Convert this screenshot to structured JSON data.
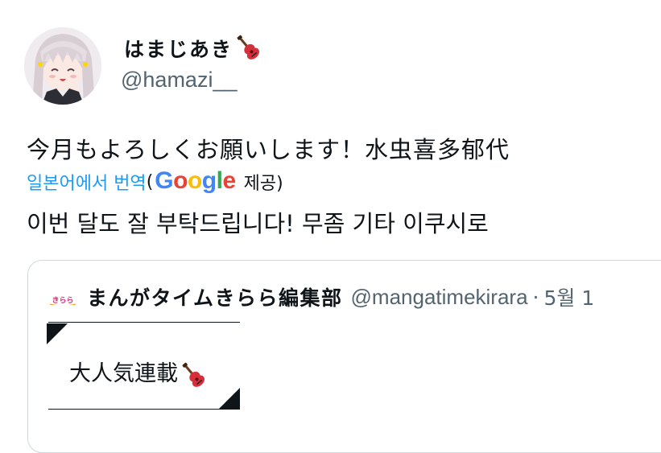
{
  "author": {
    "display_name": "はまじあき",
    "handle": "@hamazi__"
  },
  "tweet": {
    "text": "今月もよろしくお願いします！水虫喜多郁代",
    "translate_link": "일본어에서 번역",
    "paren_open": "(",
    "google_logo": "Google",
    "provided_by": "제공)",
    "translated_text": "이번 달도 잘 부탁드립니다! 무좀 기타 이쿠시로"
  },
  "quoted": {
    "avatar_text": "きらら",
    "name": "まんがタイムきらら編集部",
    "handle": "@mangatimekirara",
    "separator": "·",
    "date": "5월 1",
    "body_text": "大人気連載"
  },
  "colors": {
    "link": "#1d9bf0",
    "secondary_text": "#536471",
    "card_border": "#cfd9de",
    "google_blue": "#4285F4",
    "google_red": "#EA4335",
    "google_yellow": "#FBBC05",
    "google_green": "#34A853"
  },
  "icons": {
    "emoji": "guitar-icon",
    "avatar": "anime-girl-avatar"
  }
}
